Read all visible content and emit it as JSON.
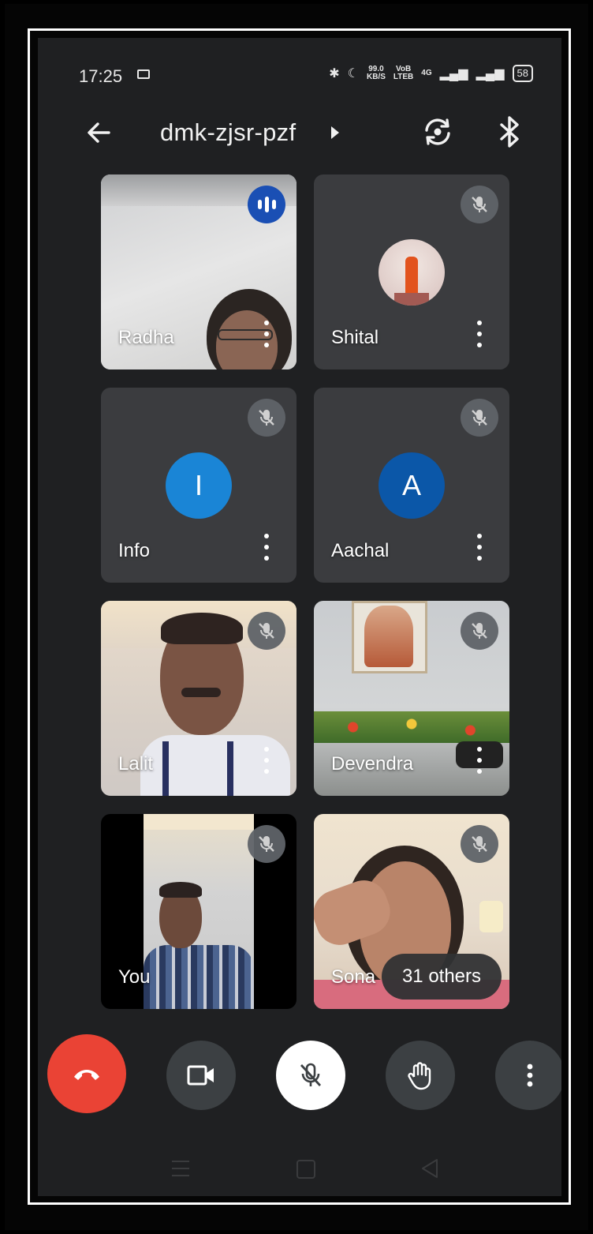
{
  "status_bar": {
    "time": "17:25",
    "speed_value": "99.0",
    "speed_unit": "KB/S",
    "volte_top": "VoB",
    "volte_bottom": "LTEB",
    "network": "4G",
    "battery": "58"
  },
  "header": {
    "meeting_code": "dmk-zjsr-pzf"
  },
  "participants": [
    {
      "name": "Radha",
      "state": "speaking",
      "icon": "speaking-indicator-icon"
    },
    {
      "name": "Shital",
      "state": "muted",
      "icon": "mic-off-icon"
    },
    {
      "name": "Info",
      "state": "muted",
      "icon": "mic-off-icon",
      "initial": "I",
      "avatar_color": "#1a85d6"
    },
    {
      "name": "Aachal",
      "state": "muted",
      "icon": "mic-off-icon",
      "initial": "A",
      "avatar_color": "#0b57a8"
    },
    {
      "name": "Lalit",
      "state": "muted",
      "icon": "mic-off-icon"
    },
    {
      "name": "Devendra",
      "state": "muted",
      "icon": "mic-off-icon"
    },
    {
      "name": "You",
      "state": "muted",
      "icon": "mic-off-icon"
    },
    {
      "name": "Sona",
      "state": "muted",
      "icon": "mic-off-icon"
    }
  ],
  "others_pill": "31 others",
  "controls": {
    "hangup": "end-call-icon",
    "camera": "camera-icon",
    "mic": "mic-off-icon",
    "hand": "raise-hand-icon",
    "more": "more-options-icon"
  },
  "colors": {
    "hangup": "#ea4335",
    "speaking": "#1a4fb4",
    "control_bg": "#3c4043",
    "background": "#1f2022"
  }
}
